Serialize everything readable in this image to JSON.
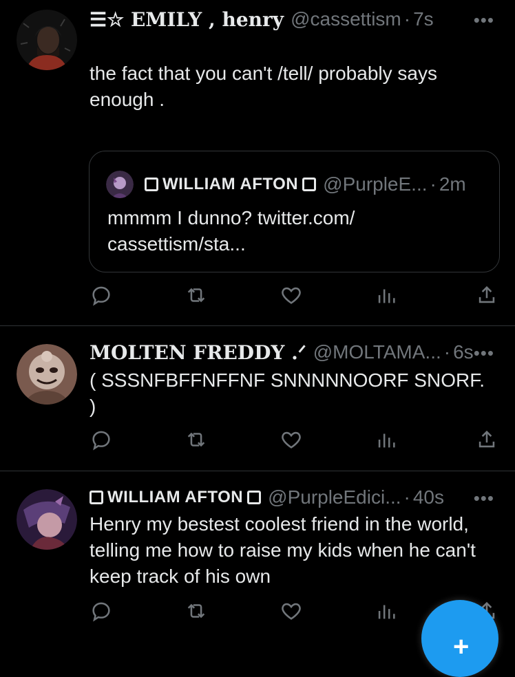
{
  "tweets": [
    {
      "name": "☰☆ EMILY , henry",
      "handle": "@cassettism",
      "time": "7s",
      "text": "the fact that you can't /tell/ probably says enough .",
      "quote": {
        "name": "WILLIAM AFTON",
        "handle": "@PurpleE...",
        "time": "2m",
        "text": "mmmm I dunno? twitter.com/ cassettism/sta..."
      }
    },
    {
      "name": "MOLTEN FREDDY .ᐟ",
      "handle": "@MOLTAMA...",
      "time": "6s",
      "text": "(  SSSNFBFFNFFNF SNNNNNOORF SNORF. )"
    },
    {
      "name": "WILLIAM AFTON",
      "handle": "@PurpleEdici...",
      "time": "40s",
      "text": "Henry my bestest coolest friend in the world, telling me how to raise my kids when he can't keep track of his own"
    }
  ],
  "common": {
    "dot": "·",
    "more": "•••",
    "fab_icon": "+"
  },
  "colors": {
    "background": "#000000",
    "text": "#e7e9ea",
    "muted": "#71767b",
    "accent": "#1d9bf0"
  }
}
